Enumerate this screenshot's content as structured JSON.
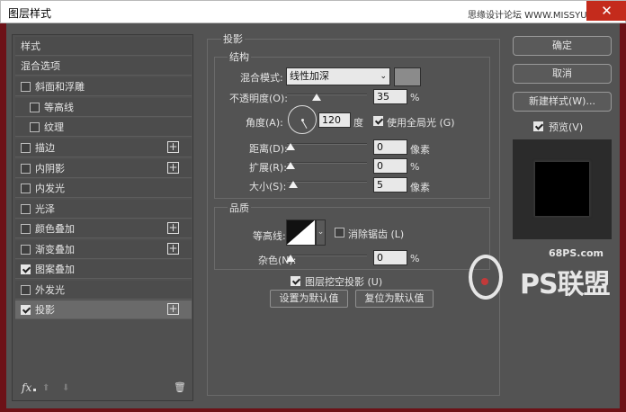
{
  "window": {
    "title": "图层样式",
    "watermark": "思缘设计论坛 WWW.MISSYUAN.COM",
    "close": "✕"
  },
  "styles_panel": {
    "items": [
      {
        "label": "样式"
      },
      {
        "label": "混合选项"
      },
      {
        "label": "斜面和浮雕",
        "checked": false
      },
      {
        "label": "等高线",
        "checked": false
      },
      {
        "label": "纹理",
        "checked": false
      },
      {
        "label": "描边",
        "checked": false,
        "plus": "+"
      },
      {
        "label": "内阴影",
        "checked": false,
        "plus": "+"
      },
      {
        "label": "内发光",
        "checked": false
      },
      {
        "label": "光泽",
        "checked": false
      },
      {
        "label": "颜色叠加",
        "checked": false,
        "plus": "+"
      },
      {
        "label": "渐变叠加",
        "checked": false,
        "plus": "+"
      },
      {
        "label": "图案叠加",
        "checked": true
      },
      {
        "label": "外发光",
        "checked": false
      },
      {
        "label": "投影",
        "checked": true,
        "plus": "+",
        "selected": true
      }
    ],
    "fx": "fx",
    "up": "⬆",
    "down": "⬇",
    "trash": "🗑"
  },
  "drop_shadow": {
    "section_title": "投影",
    "structure_title": "结构",
    "blend_mode_label": "混合模式:",
    "blend_mode_value": "线性加深",
    "shadow_color": "#8b8b8b",
    "opacity_label": "不透明度(O):",
    "opacity_value": "35",
    "opacity_unit": "%",
    "angle_label": "角度(A):",
    "angle_value": "120",
    "angle_unit": "度",
    "global_light_label": "使用全局光 (G)",
    "global_light_checked": true,
    "distance_label": "距离(D):",
    "distance_value": "0",
    "distance_unit": "像素",
    "spread_label": "扩展(R):",
    "spread_value": "0",
    "spread_unit": "%",
    "size_label": "大小(S):",
    "size_value": "5",
    "size_unit": "像素",
    "quality_title": "品质",
    "contour_label": "等高线:",
    "anti_alias_label": "消除锯齿 (L)",
    "noise_label": "杂色(N):",
    "noise_value": "0",
    "noise_unit": "%",
    "knockout_label": "图层挖空投影 (U)",
    "set_default": "设置为默认值",
    "reset_default": "复位为默认值"
  },
  "right": {
    "ok": "确定",
    "cancel": "取消",
    "new_style": "新建样式(W)...",
    "preview_label": "预览(V)"
  },
  "logo": {
    "site": "68PS.com",
    "name": "PS联盟"
  }
}
